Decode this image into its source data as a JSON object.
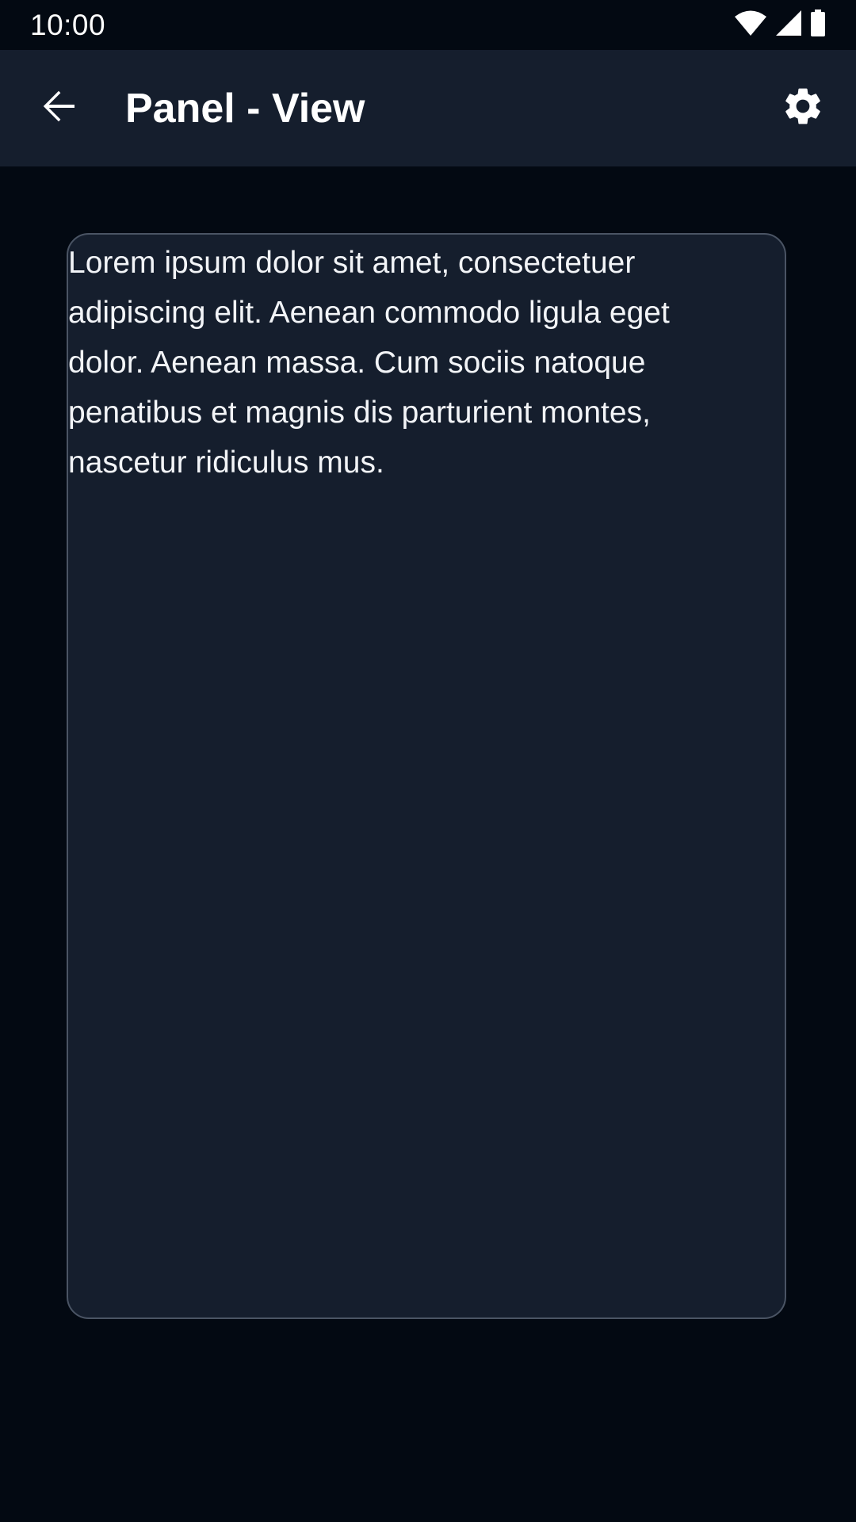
{
  "status_bar": {
    "time": "10:00",
    "icons": [
      "wifi-icon",
      "signal-icon",
      "battery-icon"
    ]
  },
  "app_bar": {
    "title": "Panel - View",
    "back_icon": "arrow-back-icon",
    "settings_icon": "gear-icon"
  },
  "panel": {
    "text": "Lorem ipsum dolor sit amet, consectetuer adipiscing elit. Aenean commodo ligula eget dolor. Aenean massa. Cum sociis natoque penatibus et magnis dis parturient montes, nascetur ridiculus mus."
  },
  "colors": {
    "background": "#030912",
    "surface": "#151e2d",
    "border": "#4a5464",
    "text": "#ffffff"
  }
}
